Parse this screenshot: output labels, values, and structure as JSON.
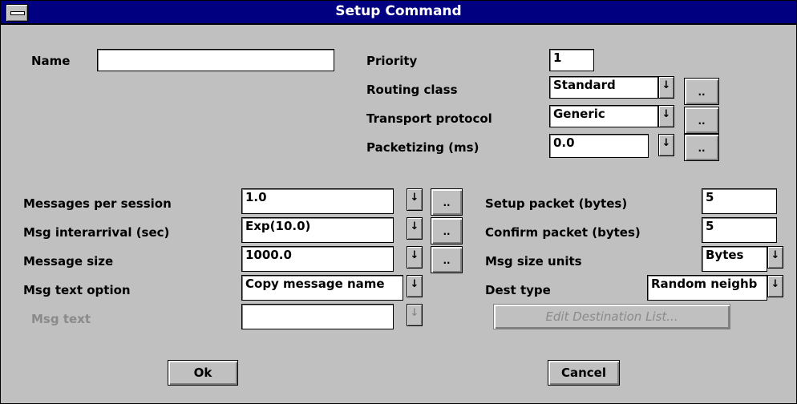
{
  "window": {
    "title": "Setup Command"
  },
  "name": {
    "label": "Name",
    "value": ""
  },
  "priority": {
    "label": "Priority",
    "value": "1"
  },
  "routing_class": {
    "label": "Routing class",
    "value": "Standard",
    "dots": ".."
  },
  "transport_protocol": {
    "label": "Transport protocol",
    "value": "Generic",
    "dots": ".."
  },
  "packetizing": {
    "label": "Packetizing (ms)",
    "value": "0.0",
    "dots": ".."
  },
  "messages_per_session": {
    "label": "Messages per session",
    "value": "1.0",
    "dots": ".."
  },
  "msg_interarrival": {
    "label": "Msg interarrival (sec)",
    "value": "Exp(10.0)",
    "dots": ".."
  },
  "message_size": {
    "label": "Message size",
    "value": "1000.0",
    "dots": ".."
  },
  "msg_text_option": {
    "label": "Msg text option",
    "value": "Copy message name"
  },
  "msg_text": {
    "label": "Msg text",
    "value": ""
  },
  "setup_packet": {
    "label": "Setup packet (bytes)",
    "value": "5"
  },
  "confirm_packet": {
    "label": "Confirm packet (bytes)",
    "value": "5"
  },
  "msg_size_units": {
    "label": "Msg size units",
    "value": "Bytes"
  },
  "dest_type": {
    "label": "Dest type",
    "value": "Random neighb"
  },
  "buttons": {
    "edit_destination_list": "Edit Destination List...",
    "ok": "Ok",
    "cancel": "Cancel"
  },
  "icons": {
    "dropdown_arrow": "↓",
    "system_menu": "system-menu-icon"
  }
}
